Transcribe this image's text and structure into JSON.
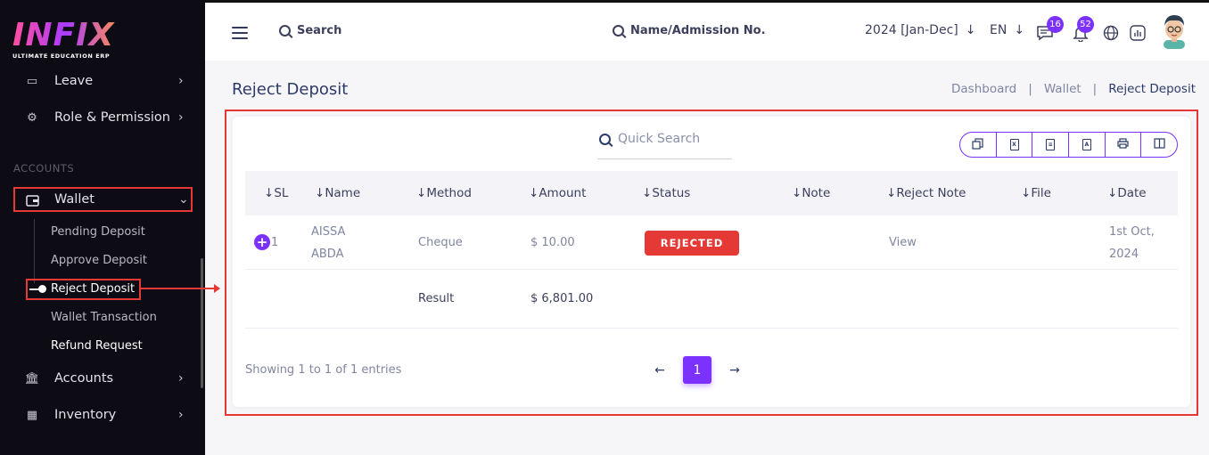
{
  "app": {
    "logo": "INFIX",
    "logo_sub": "ULTIMATE EDUCATION ERP"
  },
  "sidebar": {
    "items_top": [
      {
        "label": "Leave",
        "icon": "leave-icon"
      },
      {
        "label": "Role & Permission",
        "icon": "role-permission-icon"
      }
    ],
    "section_label": "ACCOUNTS",
    "wallet": {
      "label": "Wallet",
      "icon": "wallet-icon"
    },
    "wallet_sub": [
      "Pending Deposit",
      "Approve Deposit",
      "Reject Deposit",
      "Wallet Transaction",
      "Refund Request"
    ],
    "items_bottom": [
      {
        "label": "Accounts",
        "icon": "bank-icon"
      },
      {
        "label": "Inventory",
        "icon": "inventory-icon"
      }
    ]
  },
  "header": {
    "search_label": "Search",
    "student_search_label": "Name/Admission No.",
    "year": "2024 [Jan-Dec]",
    "lang": "EN",
    "messages_count": "16",
    "notifications_count": "52"
  },
  "page": {
    "title": "Reject Deposit",
    "breadcrumbs": [
      "Dashboard",
      "Wallet",
      "Reject Deposit"
    ]
  },
  "table": {
    "search_placeholder": "Quick Search",
    "columns": [
      "SL",
      "Name",
      "Method",
      "Amount",
      "Status",
      "Note",
      "Reject Note",
      "File",
      "Date"
    ],
    "rows": [
      {
        "sl": "1",
        "name_line1": "AISSA",
        "name_line2": "ABDA",
        "method": "Cheque",
        "amount": "$ 10.00",
        "status": "REJECTED",
        "note": "",
        "reject_note": "View",
        "file": "",
        "date_line1": "1st Oct,",
        "date_line2": "2024"
      }
    ],
    "result_label": "Result",
    "result_amount": "$ 6,801.00",
    "info": "Showing 1 to 1 of 1 entries",
    "current_page": "1"
  },
  "colors": {
    "accent": "#7c32ff",
    "highlight": "#e53935",
    "sidebar_bg": "#0d0b14"
  }
}
